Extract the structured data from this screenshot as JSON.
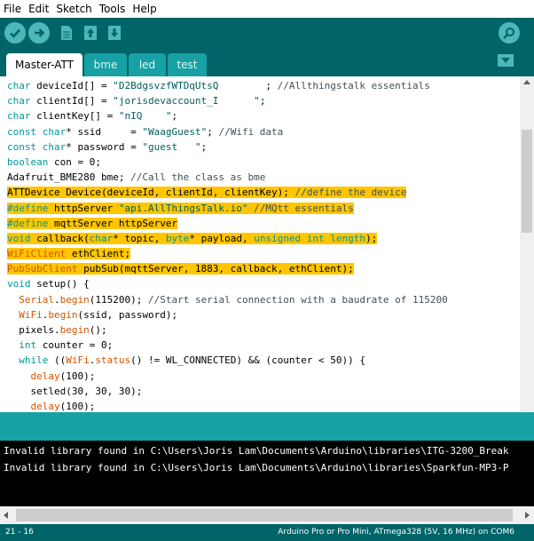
{
  "menu": [
    "File",
    "Edit",
    "Sketch",
    "Tools",
    "Help"
  ],
  "toolbar": {
    "icons": [
      "verify-icon",
      "upload-icon",
      "new-icon",
      "open-icon",
      "save-icon",
      "serial-monitor-icon"
    ]
  },
  "tabs": [
    {
      "label": "Master-ATT",
      "active": true
    },
    {
      "label": "bme",
      "active": false
    },
    {
      "label": "led",
      "active": false
    },
    {
      "label": "test",
      "active": false
    }
  ],
  "editor": {
    "lines": [
      {
        "highlight": false,
        "segments": [
          {
            "t": "kw",
            "v": "char"
          },
          {
            "t": "",
            "v": " deviceId[] = "
          },
          {
            "t": "st",
            "v": "\"D2BdgsvzfWTDqUtsQ"
          },
          {
            "t": "mask",
            "v": "        "
          },
          {
            "t": "",
            "v": "; "
          },
          {
            "t": "cm",
            "v": "//Allthingstalk essentials"
          }
        ]
      },
      {
        "highlight": false,
        "segments": [
          {
            "t": "kw",
            "v": "char"
          },
          {
            "t": "",
            "v": " clientId[] = "
          },
          {
            "t": "st",
            "v": "\"jorisdevaccount_I"
          },
          {
            "t": "mask",
            "v": "      "
          },
          {
            "t": "st",
            "v": "\""
          },
          {
            "t": "",
            "v": ";"
          }
        ]
      },
      {
        "highlight": false,
        "segments": [
          {
            "t": "kw",
            "v": "char"
          },
          {
            "t": "",
            "v": " clientKey[] = "
          },
          {
            "t": "st",
            "v": "\"nIQ"
          },
          {
            "t": "mask",
            "v": "    "
          },
          {
            "t": "st",
            "v": "\""
          },
          {
            "t": "",
            "v": ";"
          }
        ]
      },
      {
        "highlight": false,
        "segments": [
          {
            "t": "kw",
            "v": "const"
          },
          {
            "t": "",
            "v": " "
          },
          {
            "t": "kw",
            "v": "char"
          },
          {
            "t": "",
            "v": "* ssid     = "
          },
          {
            "t": "st",
            "v": "\"WaagGuest\""
          },
          {
            "t": "",
            "v": "; "
          },
          {
            "t": "cm",
            "v": "//Wifi data"
          }
        ]
      },
      {
        "highlight": false,
        "segments": [
          {
            "t": "kw",
            "v": "const"
          },
          {
            "t": "",
            "v": " "
          },
          {
            "t": "kw",
            "v": "char"
          },
          {
            "t": "",
            "v": "* password = "
          },
          {
            "t": "st",
            "v": "\"guest"
          },
          {
            "t": "mask",
            "v": "   "
          },
          {
            "t": "st",
            "v": "\""
          },
          {
            "t": "",
            "v": ";"
          }
        ]
      },
      {
        "highlight": false,
        "segments": [
          {
            "t": "kw",
            "v": "boolean"
          },
          {
            "t": "",
            "v": " con = 0;"
          }
        ]
      },
      {
        "highlight": false,
        "segments": [
          {
            "t": "",
            "v": "Adafruit_BME280 bme; "
          },
          {
            "t": "cm",
            "v": "//Call the class as bme"
          }
        ]
      },
      {
        "highlight": true,
        "segments": [
          {
            "t": "",
            "v": "ATTDevice Device(deviceId, clientId, clientKey); "
          },
          {
            "t": "cm",
            "v": "//define the device"
          }
        ]
      },
      {
        "highlight": true,
        "segments": [
          {
            "t": "kw",
            "v": "#define"
          },
          {
            "t": "",
            "v": " httpServer "
          },
          {
            "t": "st",
            "v": "\"api.AllThingsTalk.io\""
          },
          {
            "t": "",
            "v": " "
          },
          {
            "t": "cm",
            "v": "//MQtt essentials"
          }
        ]
      },
      {
        "highlight": true,
        "segments": [
          {
            "t": "kw",
            "v": "#define"
          },
          {
            "t": "",
            "v": " mqttServer httpServer"
          }
        ]
      },
      {
        "highlight": true,
        "segments": [
          {
            "t": "kw",
            "v": "void"
          },
          {
            "t": "",
            "v": " callback("
          },
          {
            "t": "kw",
            "v": "char"
          },
          {
            "t": "",
            "v": "* topic, "
          },
          {
            "t": "kw",
            "v": "byte"
          },
          {
            "t": "",
            "v": "* payload, "
          },
          {
            "t": "kw",
            "v": "unsigned"
          },
          {
            "t": "",
            "v": " "
          },
          {
            "t": "kw",
            "v": "int"
          },
          {
            "t": "",
            "v": " "
          },
          {
            "t": "kw",
            "v": "length"
          },
          {
            "t": "",
            "v": ");"
          }
        ]
      },
      {
        "highlight": true,
        "segments": [
          {
            "t": "fn",
            "v": "WiFiClient"
          },
          {
            "t": "",
            "v": " ethClient;"
          }
        ]
      },
      {
        "highlight": true,
        "segments": [
          {
            "t": "fn",
            "v": "PubSubClient"
          },
          {
            "t": "",
            "v": " pubSub(mqttServer, 1883, callback, ethClient);"
          }
        ]
      },
      {
        "highlight": false,
        "segments": [
          {
            "t": "kw",
            "v": "void"
          },
          {
            "t": "",
            "v": " "
          },
          {
            "t": "",
            "v": "setup() {"
          }
        ]
      },
      {
        "highlight": false,
        "segments": [
          {
            "t": "",
            "v": "  "
          },
          {
            "t": "fn",
            "v": "Serial"
          },
          {
            "t": "",
            "v": "."
          },
          {
            "t": "fn",
            "v": "begin"
          },
          {
            "t": "",
            "v": "(115200); "
          },
          {
            "t": "cm",
            "v": "//Start serial connection with a baudrate of 115200"
          }
        ]
      },
      {
        "highlight": false,
        "segments": [
          {
            "t": "",
            "v": "  "
          },
          {
            "t": "fn",
            "v": "WiFi"
          },
          {
            "t": "",
            "v": "."
          },
          {
            "t": "fn",
            "v": "begin"
          },
          {
            "t": "",
            "v": "(ssid, password);"
          }
        ]
      },
      {
        "highlight": false,
        "segments": [
          {
            "t": "",
            "v": "  pixels."
          },
          {
            "t": "fn",
            "v": "begin"
          },
          {
            "t": "",
            "v": "();"
          }
        ]
      },
      {
        "highlight": false,
        "segments": [
          {
            "t": "",
            "v": "  "
          },
          {
            "t": "kw",
            "v": "int"
          },
          {
            "t": "",
            "v": " counter = 0;"
          }
        ]
      },
      {
        "highlight": false,
        "segments": [
          {
            "t": "",
            "v": "  "
          },
          {
            "t": "kw",
            "v": "while"
          },
          {
            "t": "",
            "v": " (("
          },
          {
            "t": "fn",
            "v": "WiFi"
          },
          {
            "t": "",
            "v": "."
          },
          {
            "t": "fn",
            "v": "status"
          },
          {
            "t": "",
            "v": "() != WL_CONNECTED) && (counter < 50)) {"
          }
        ]
      },
      {
        "highlight": false,
        "segments": [
          {
            "t": "",
            "v": "    "
          },
          {
            "t": "fn",
            "v": "delay"
          },
          {
            "t": "",
            "v": "(100);"
          }
        ]
      },
      {
        "highlight": false,
        "segments": [
          {
            "t": "",
            "v": "    setled(30, 30, 30);"
          }
        ]
      },
      {
        "highlight": false,
        "segments": [
          {
            "t": "",
            "v": "    "
          },
          {
            "t": "fn",
            "v": "delay"
          },
          {
            "t": "",
            "v": "(100);"
          }
        ]
      }
    ]
  },
  "console": {
    "lines": [
      "Invalid library found in C:\\Users\\Joris Lam\\Documents\\Arduino\\libraries\\ITG-3200_Break",
      "Invalid library found in C:\\Users\\Joris Lam\\Documents\\Arduino\\libraries\\Sparkfun-MP3-P"
    ]
  },
  "status": {
    "cursor": "21 - 16",
    "board": "Arduino Pro or Pro Mini, ATmega328 (5V, 16 MHz) on COM6"
  },
  "colors": {
    "teal_dark": "#006468",
    "teal_mid": "#17a1a5",
    "teal_light": "#4db7bb",
    "highlight": "#ffc600",
    "keyword": "#00979c",
    "function": "#d35400"
  }
}
